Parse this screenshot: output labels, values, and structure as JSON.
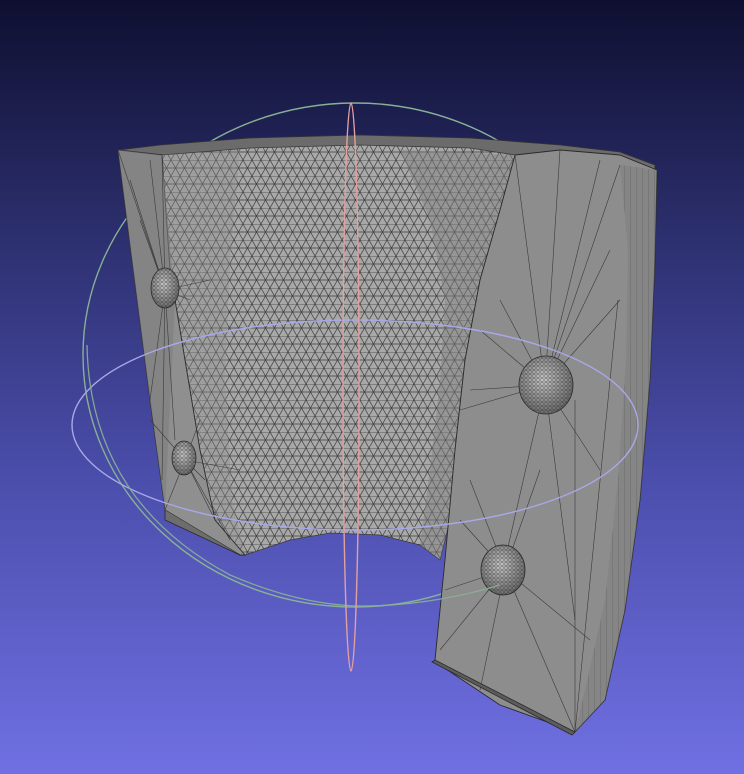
{
  "viewer": {
    "background_top": "#0e0f30",
    "background_bottom": "#7070e3",
    "mesh_color": "#9a9a9a",
    "wire_color": "#3b3b3b",
    "trackball": {
      "vertical_axis_color": "#e4a0a0",
      "green_ring_color": "#88b096",
      "blue_ring_color": "#a8a8e8"
    },
    "cursor_mode": "trackball-rotate"
  }
}
